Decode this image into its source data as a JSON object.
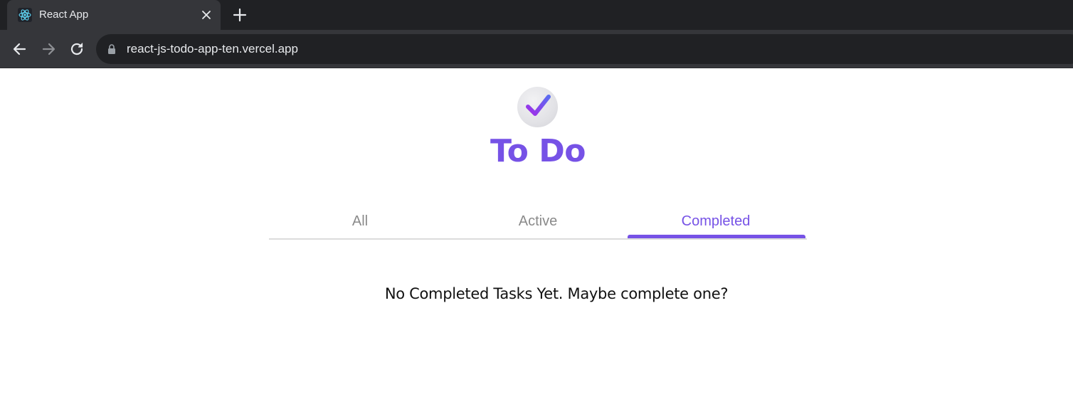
{
  "browser": {
    "tab_title": "React App",
    "url": "react-js-todo-app-ten.vercel.app",
    "icons": {
      "favicon": "react-logo-icon",
      "close": "close-icon",
      "new_tab": "plus-icon",
      "back": "arrow-left-icon",
      "forward": "arrow-right-icon",
      "reload": "reload-icon",
      "lock": "lock-icon"
    }
  },
  "app": {
    "logo": "checkmark-icon",
    "title": "To Do",
    "accent_color": "#7652e6",
    "filters": [
      {
        "label": "All",
        "active": false
      },
      {
        "label": "Active",
        "active": false
      },
      {
        "label": "Completed",
        "active": true
      }
    ],
    "empty_message": "No Completed Tasks Yet. Maybe complete one?"
  }
}
